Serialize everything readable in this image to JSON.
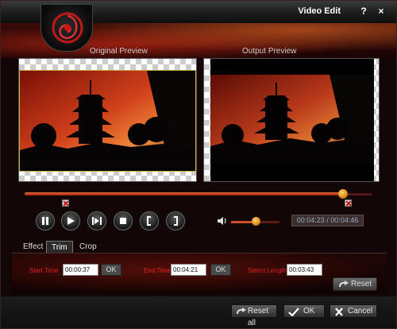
{
  "window": {
    "title": "Video Edit",
    "help_glyph": "?",
    "close_glyph": "×"
  },
  "previews": {
    "original_label": "Original Preview",
    "output_label": "Output Preview"
  },
  "timeline": {
    "progress": 0.915
  },
  "volume": {
    "level": 0.5
  },
  "time_display": "00:04:23 / 00:04:46",
  "tabs": [
    {
      "label": "Effect",
      "active": false
    },
    {
      "label": "Trim",
      "active": true
    },
    {
      "label": "Crop",
      "active": false
    }
  ],
  "trim": {
    "start_label": "Start Time",
    "start_value": "00:00:37",
    "end_label": "End Time",
    "end_value": "00:04:21",
    "length_label": "Select Length",
    "length_value": "00:03:43",
    "ok_label": "OK",
    "reset_label": "Reset"
  },
  "footer": {
    "reset_all_label": "Reset all",
    "ok_label": "OK",
    "cancel_label": "Cancel"
  },
  "icons": {
    "logo": "spiral-logo-icon",
    "pause": "pause-icon",
    "play": "play-icon",
    "next_frame": "next-frame-icon",
    "stop": "stop-icon",
    "mark_in": "mark-in-icon",
    "mark_out": "mark-out-icon",
    "volume": "speaker-icon"
  },
  "colors": {
    "accent_red": "#e02020",
    "knob_orange": "#d98a10"
  }
}
